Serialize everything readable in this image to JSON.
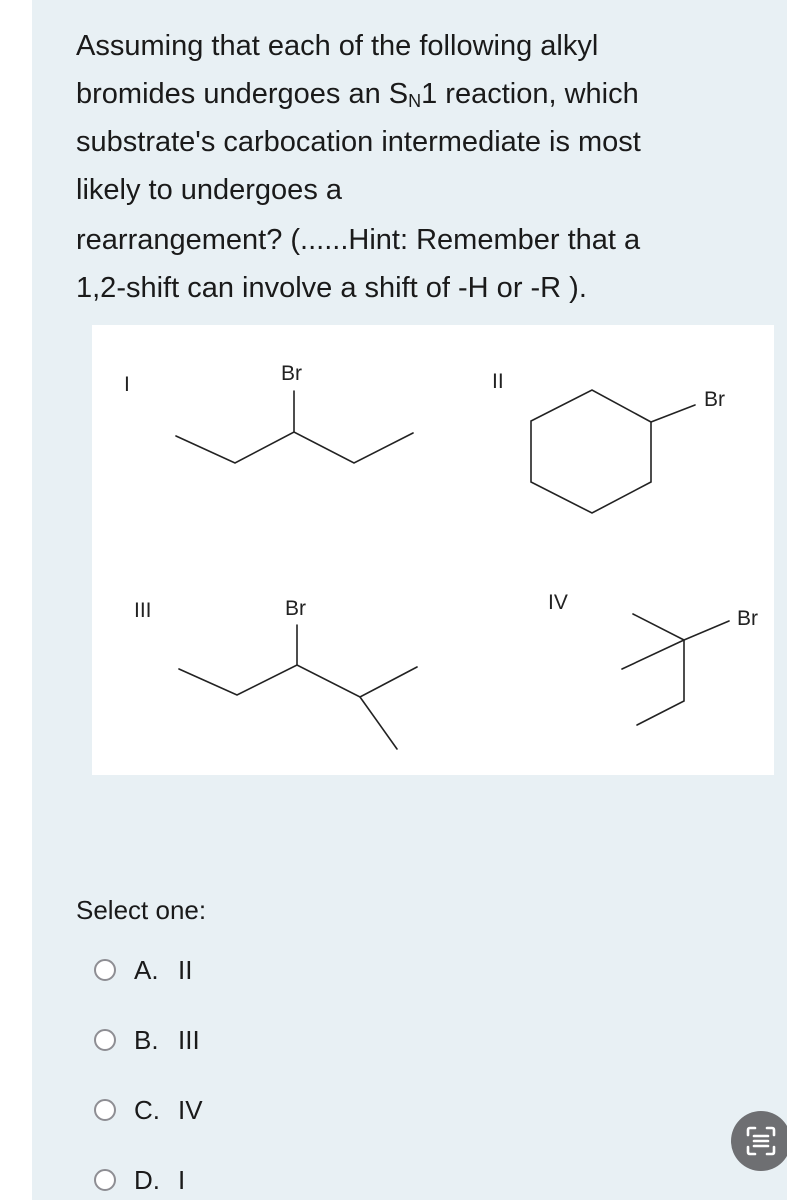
{
  "question": {
    "line1": "Assuming that each of the following alkyl",
    "line2_pre": "bromides undergoes an S",
    "line2_sub": "N",
    "line2_post": "1 reaction, which",
    "line3": "substrate's carbocation intermediate is most",
    "line4": "likely to undergoes a",
    "line5": "rearrangement?  (......Hint:  Remember that a",
    "line6": "1,2-shift can involve a shift of -H or -R )."
  },
  "figure": {
    "structures": [
      {
        "label": "I",
        "substituent": "Br",
        "name": "3-bromopentane"
      },
      {
        "label": "II",
        "substituent": "Br",
        "name": "bromocyclohexane"
      },
      {
        "label": "III",
        "substituent": "Br",
        "name": "3-bromo-2-methylpentane"
      },
      {
        "label": "IV",
        "substituent": "Br",
        "name": "2-bromo-2-methylbutane"
      }
    ]
  },
  "select_label": "Select one:",
  "options": [
    {
      "letter": "A.",
      "value": "II",
      "selected": false
    },
    {
      "letter": "B.",
      "value": "III",
      "selected": false
    },
    {
      "letter": "C.",
      "value": "IV",
      "selected": false
    },
    {
      "letter": "D.",
      "value": "I",
      "selected": false
    }
  ],
  "fab": {
    "icon": "scan-text-icon"
  },
  "colors": {
    "background": "#e8f0f4",
    "panel": "#ffffff",
    "fab": "#6e6f72",
    "radio_border": "#8e8e93"
  }
}
